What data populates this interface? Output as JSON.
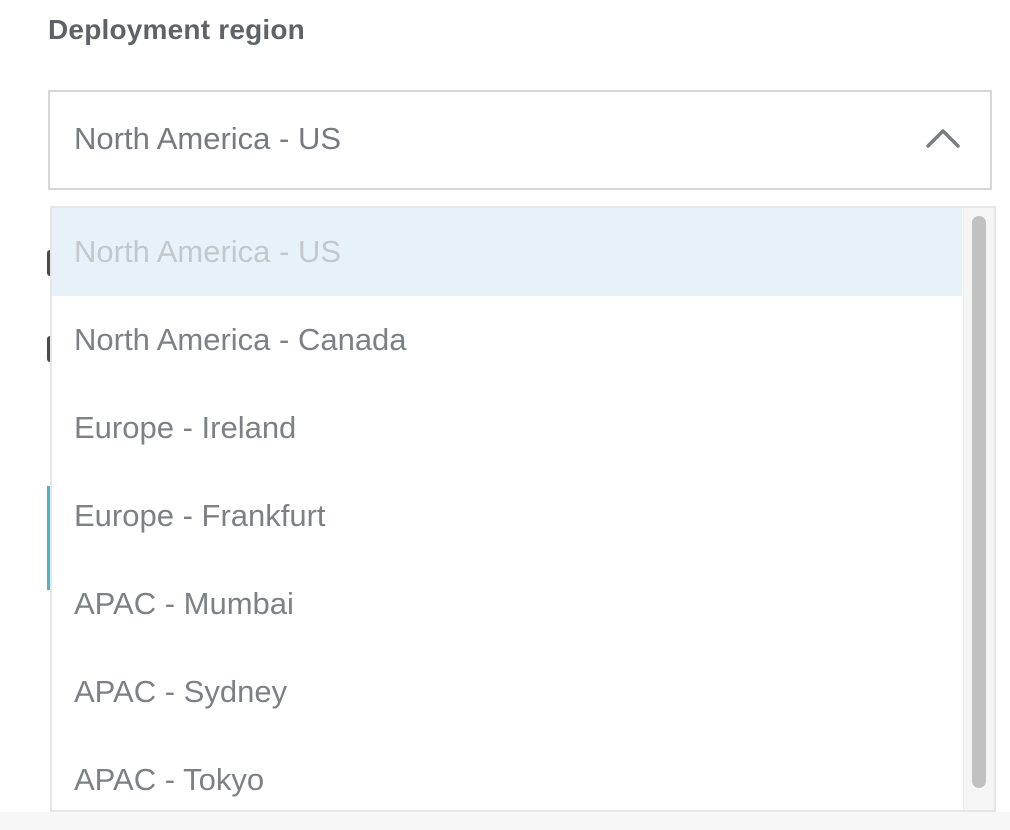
{
  "field": {
    "label": "Deployment region",
    "selected_value": "North America - US",
    "chevron_icon": "chevron-up-icon"
  },
  "dropdown": {
    "options": [
      {
        "label": "North America - US",
        "selected": true
      },
      {
        "label": "North America - Canada",
        "selected": false
      },
      {
        "label": "Europe - Ireland",
        "selected": false
      },
      {
        "label": "Europe - Frankfurt",
        "selected": false
      },
      {
        "label": "APAC - Mumbai",
        "selected": false
      },
      {
        "label": "APAC - Sydney",
        "selected": false
      },
      {
        "label": "APAC - Tokyo",
        "selected": false
      }
    ]
  },
  "colors": {
    "label_text": "#5f6368",
    "option_text": "#7d8185",
    "selected_option_bg": "#e7f2f8",
    "selected_option_text": "#c3c8cc",
    "border": "#d6d6d6",
    "accent": "#4fb3c8"
  }
}
